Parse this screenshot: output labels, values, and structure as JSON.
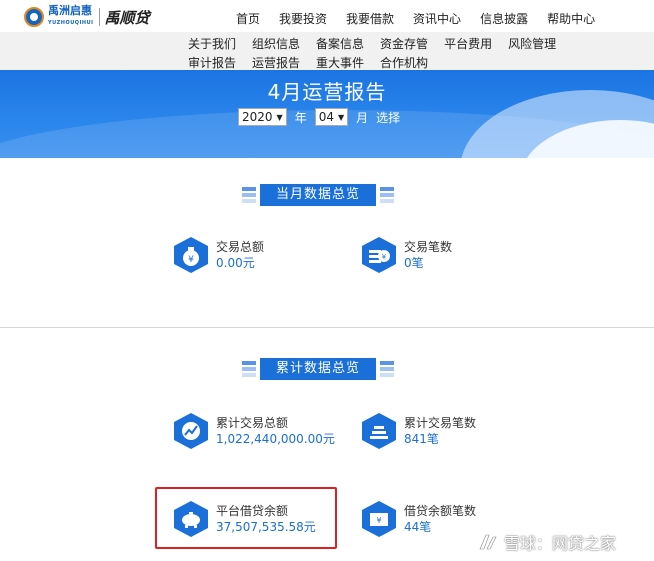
{
  "logo": {
    "name": "禹洲启惠",
    "sub": "YUZHOUQIHUI",
    "brand": "禹顺贷"
  },
  "main_nav": [
    "首页",
    "我要投资",
    "我要借款",
    "资讯中心",
    "信息披露",
    "帮助中心"
  ],
  "sub_nav_row1": [
    "关于我们",
    "组织信息",
    "备案信息",
    "资金存管",
    "平台费用",
    "风险管理"
  ],
  "sub_nav_row2": [
    "审计报告",
    "运营报告",
    "重大事件",
    "合作机构"
  ],
  "banner": {
    "title": "4月运营报告",
    "year_value": "2020",
    "year_label": "年",
    "month_value": "04",
    "month_label": "月",
    "select_label": "选择"
  },
  "monthly": {
    "title": "当月数据总览",
    "items": [
      {
        "label": "交易总额",
        "value": "0.00元",
        "icon": "money-bag-icon"
      },
      {
        "label": "交易笔数",
        "value": "0笔",
        "icon": "coins-icon"
      }
    ]
  },
  "cumulative": {
    "title": "累计数据总览",
    "items": [
      {
        "label": "累计交易总额",
        "value": "1,022,440,000.00元",
        "icon": "trend-chart-icon"
      },
      {
        "label": "累计交易笔数",
        "value": "841笔",
        "icon": "stacked-bars-icon"
      },
      {
        "label": "平台借贷余额",
        "value": "37,507,535.58元",
        "icon": "piggy-bank-icon"
      },
      {
        "label": "借贷余额笔数",
        "value": "44笔",
        "icon": "wallet-icon"
      }
    ]
  },
  "watermark": "雪球：网贷之家",
  "colors": {
    "primary": "#1b6fd8",
    "banner": "#1b74e2",
    "highlight": "#e02020"
  }
}
